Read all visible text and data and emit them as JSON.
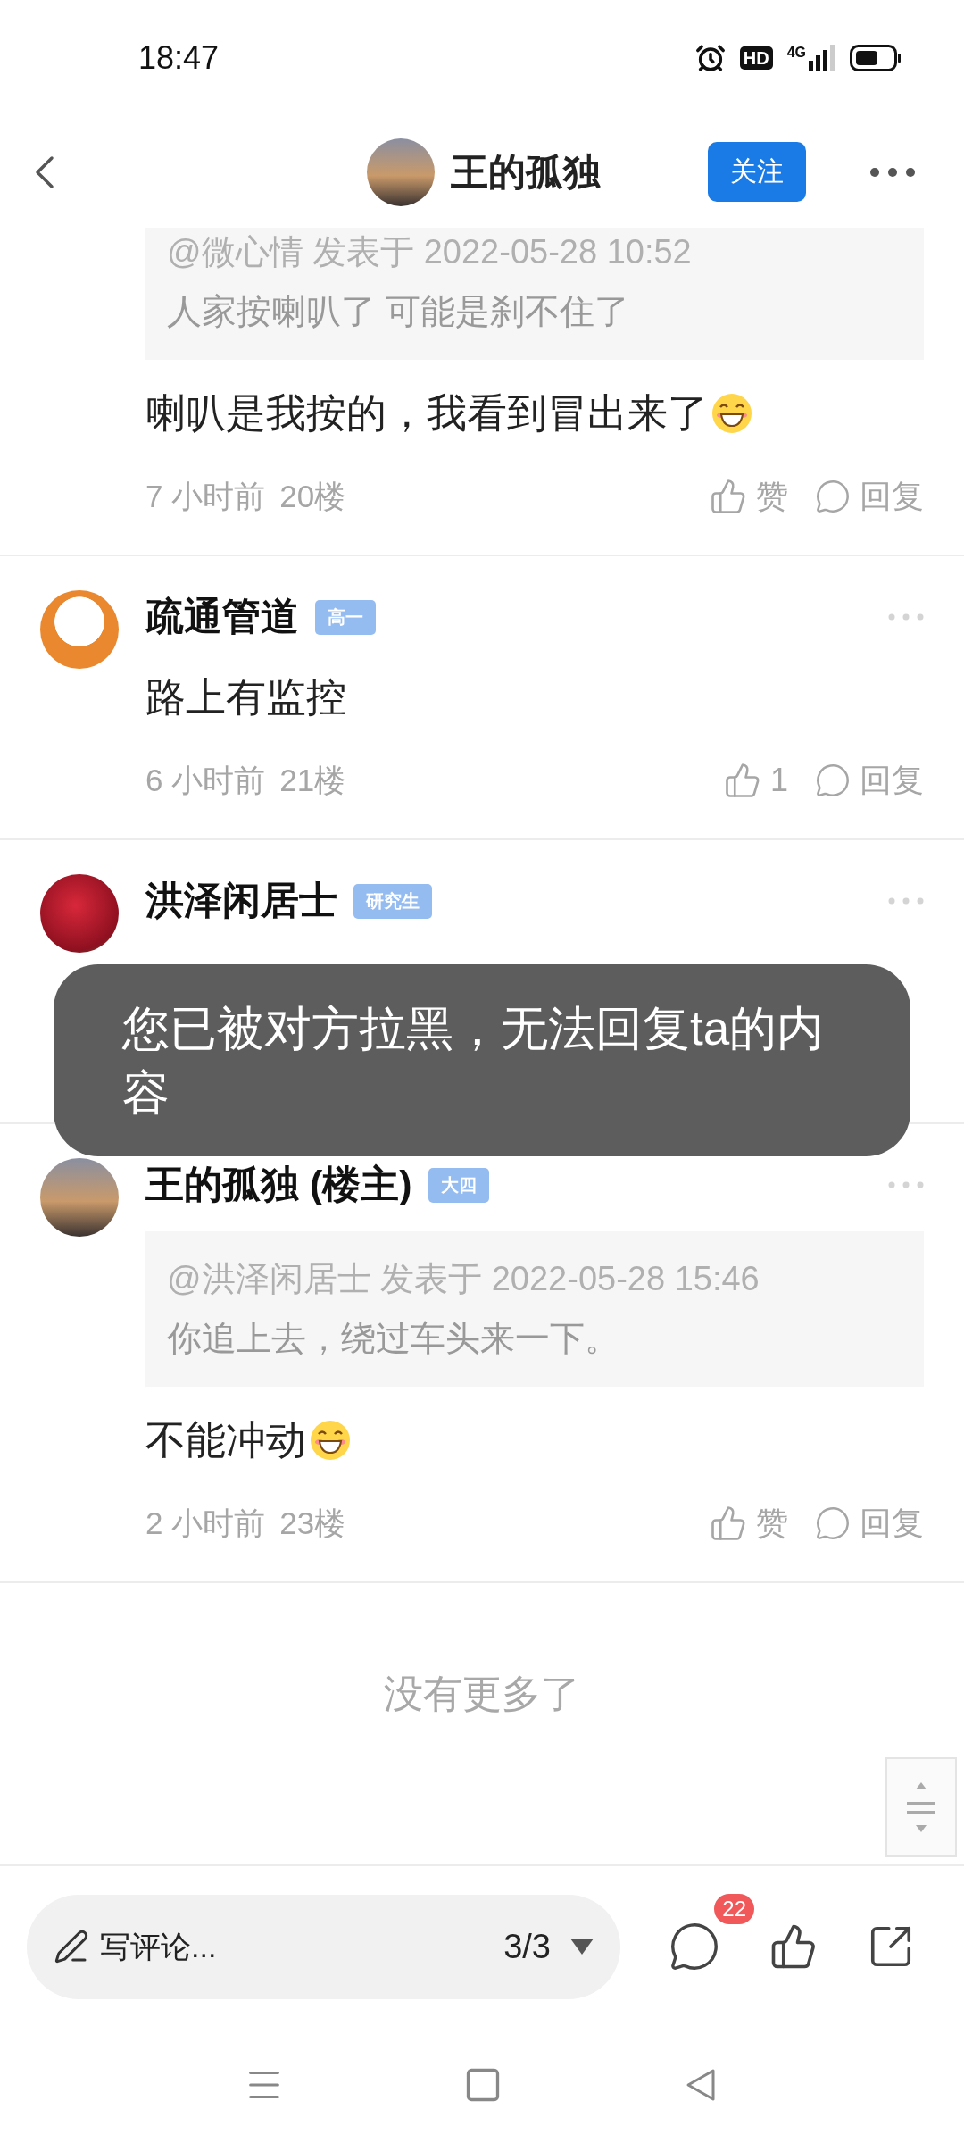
{
  "status_bar": {
    "time": "18:47",
    "hd": "HD",
    "network": "4G"
  },
  "header": {
    "title": "王的孤独",
    "follow_button": "关注"
  },
  "comments": [
    {
      "kind": "continued",
      "quote": {
        "author_line": "@微心情 发表于 2022-05-28 10:52",
        "text": "人家按喇叭了  可能是刹不住了"
      },
      "content": "喇叭是我按的，我看到冒出来了",
      "emoji": true,
      "time": "7 小时前",
      "floor": "20楼",
      "like_label": "赞",
      "reply_label": "回复"
    },
    {
      "kind": "full",
      "name": "疏通管道",
      "badge": "高一",
      "content": "路上有监控",
      "emoji": false,
      "time": "6 小时前",
      "floor": "21楼",
      "like_label": "1",
      "reply_label": "回复"
    },
    {
      "kind": "covered",
      "name": "洪泽闲居士",
      "badge": "研究生"
    },
    {
      "kind": "full",
      "name": "王的孤独 (楼主)",
      "badge": "大四",
      "quote": {
        "author_line": "@洪泽闲居士 发表于 2022-05-28 15:46",
        "text": "你追上去，绕过车头来一下。"
      },
      "content": "不能冲动",
      "emoji": true,
      "time": "2 小时前",
      "floor": "23楼",
      "like_label": "赞",
      "reply_label": "回复"
    }
  ],
  "end_text": "没有更多了",
  "bottom_bar": {
    "placeholder": "写评论...",
    "page": "3/3",
    "comment_count": "22"
  },
  "toast": {
    "message": "您已被对方拉黑，无法回复ta的内容"
  }
}
